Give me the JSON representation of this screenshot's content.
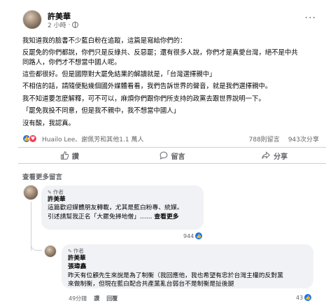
{
  "post": {
    "author": "許美華",
    "time": "2 小時",
    "paragraphs": [
      "我知道我的臉書不少藍白粉在追蹤，這篇是寫給你們的：",
      "反罷免的你們都說，你們只是反綠共、反惡罷；還有很多人說，你們才是真愛台灣，絕不是中共同路人，你們才不想當中國人呢。",
      "這些都很好。但是國際對大罷免結果的解讀就是，「台灣選擇親中」",
      "不相信的話，請隨便點幾個國外媒體看看，我們告訴世界的聲音，就是我們選擇親中。",
      "我不知道要怎麼解釋，可不可以，麻煩你們跟你們所支持的政黨去跟世界說明一下。",
      "「罷免我投不同意，但是我不親中，我不想當中國人」",
      "沒有酸，我認真。"
    ]
  },
  "reactions": {
    "names": "Huailo Lee、謝佩芳和其他1.1 萬人",
    "comments_count": "788則留言",
    "shares_count": "943次分享"
  },
  "actions": {
    "like": "讚",
    "comment": "留言",
    "share": "分享"
  },
  "more_comments": "查看更多留言",
  "comment1": {
    "badge": "作者",
    "author": "許美華",
    "line1": "這篇歡迎媒體朋友轉載，尤其是藍白粉專、統媒。",
    "line2": "引述請幫我正名「大罷免掃地僧」……",
    "see_more": "查看更多",
    "likes": "944"
  },
  "comment2": {
    "badge": "作者",
    "author": "許美華",
    "mention": "張瑋鑫",
    "line1": "昨天有位顧先生來說是為了制衡（我回應他，我也希望有忠於台灣主權的反對黨",
    "line2": "來做制衡，但現在藍白配合共產黨亂台弱台不是制衡是扯後腿",
    "time": "49分鐘",
    "like_label": "讚",
    "reply_label": "回覆",
    "likes": "43"
  }
}
